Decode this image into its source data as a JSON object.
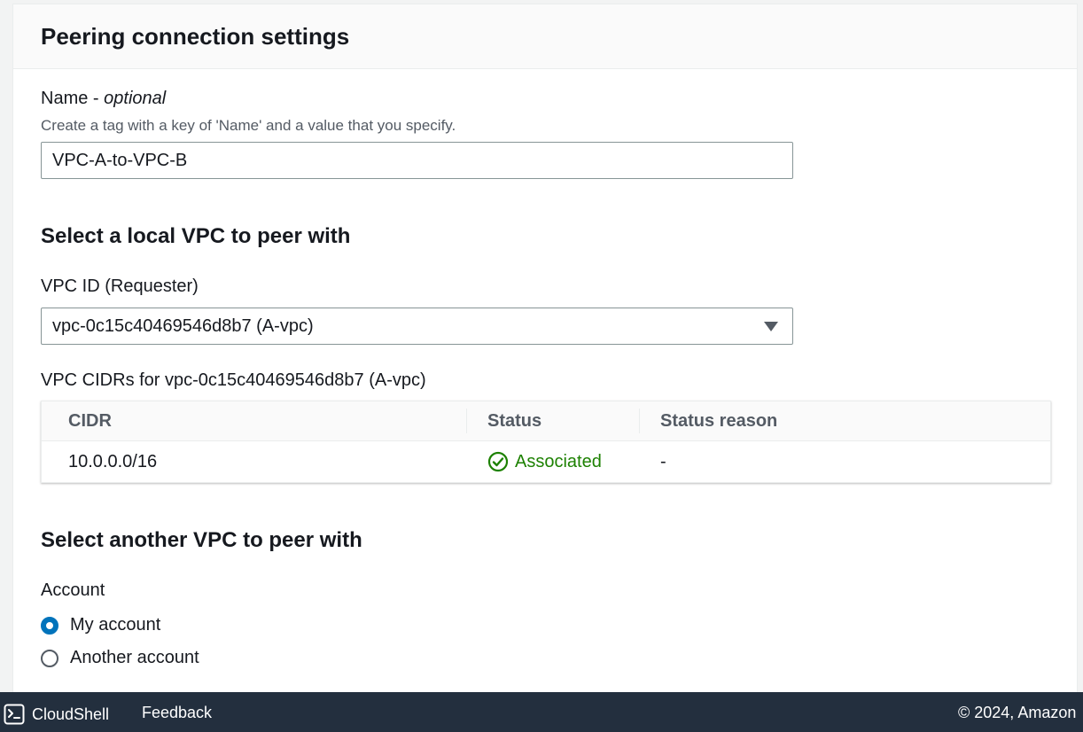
{
  "panel": {
    "title": "Peering connection settings"
  },
  "name_field": {
    "label": "Name",
    "label_suffix": "optional",
    "description": "Create a tag with a key of 'Name' and a value that you specify.",
    "value": "VPC-A-to-VPC-B"
  },
  "local_vpc": {
    "section_title": "Select a local VPC to peer with",
    "vpc_id_label": "VPC ID (Requester)",
    "vpc_id_value": "vpc-0c15c40469546d8b7 (A-vpc)",
    "cidrs_label": "VPC CIDRs for vpc-0c15c40469546d8b7 (A-vpc)",
    "table": {
      "columns": [
        "CIDR",
        "Status",
        "Status reason"
      ],
      "rows": [
        {
          "cidr": "10.0.0.0/16",
          "status": "Associated",
          "status_reason": "-"
        }
      ]
    }
  },
  "another_vpc": {
    "section_title": "Select another VPC to peer with",
    "account_label": "Account",
    "options": [
      {
        "label": "My account",
        "checked": true
      },
      {
        "label": "Another account",
        "checked": false
      }
    ]
  },
  "footer": {
    "cloudshell": "CloudShell",
    "feedback": "Feedback",
    "copyright": "© 2024, Amazon"
  },
  "colors": {
    "accent": "#0073bb",
    "success": "#1d8102",
    "footer_bg": "#232f3e"
  }
}
